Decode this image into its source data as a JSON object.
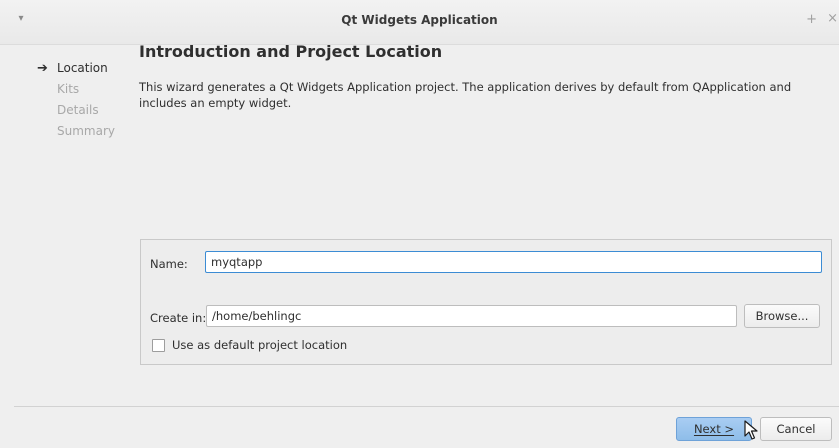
{
  "window": {
    "title": "Qt Widgets Application",
    "pin_glyph": "+",
    "close_glyph": "×",
    "menu_glyph": "▾"
  },
  "steps": [
    {
      "label": "Location",
      "current": true
    },
    {
      "label": "Kits",
      "current": false
    },
    {
      "label": "Details",
      "current": false
    },
    {
      "label": "Summary",
      "current": false
    }
  ],
  "page": {
    "heading": "Introduction and Project Location",
    "description": "This wizard generates a Qt Widgets Application project. The application derives by default from QApplication and includes an empty widget."
  },
  "form": {
    "name_label": "Name:",
    "name_value": "myqtapp",
    "create_in_label": "Create in:",
    "create_in_value": "/home/behlingc",
    "browse_label": "Browse...",
    "default_location_label": "Use as default project location",
    "default_location_checked": false
  },
  "footer": {
    "next_label": "Next >",
    "cancel_label": "Cancel"
  },
  "icons": {
    "current_step": "arrow-right-icon",
    "cursor": "mouse-pointer-icon"
  }
}
